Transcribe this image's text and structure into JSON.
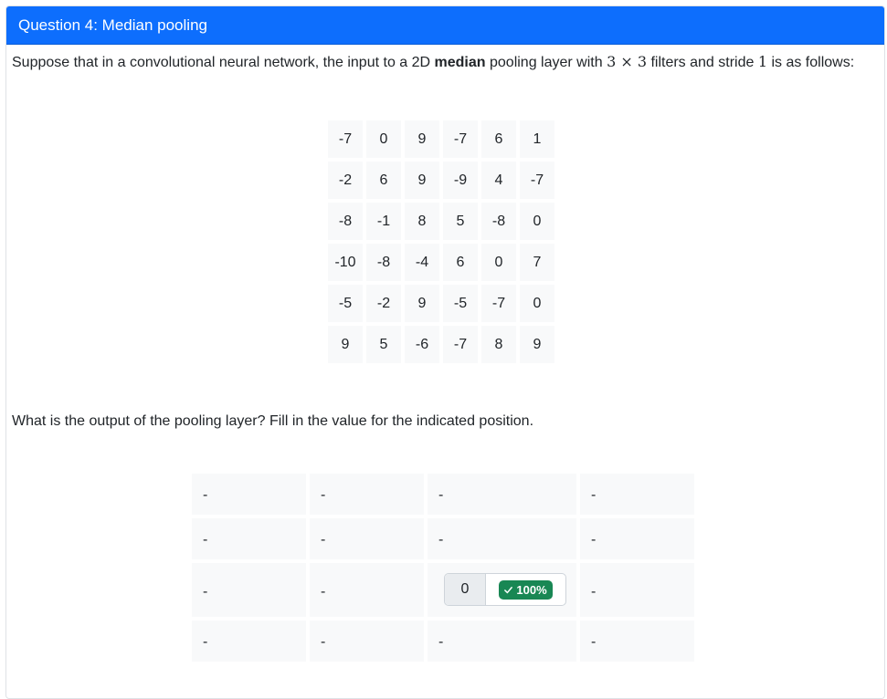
{
  "question": {
    "title": "Question 4: Median pooling",
    "prompt_before": "Suppose that in a convolutional neural network, the input to a 2D ",
    "prompt_bold": "median",
    "prompt_mid1": " pooling layer with ",
    "filter_size": "3 × 3",
    "prompt_mid2": " filters and stride ",
    "stride": "1",
    "prompt_after": " is as follows:",
    "follow_up": "What is the output of the pooling layer? Fill in the value for the indicated position."
  },
  "input_matrix": [
    [
      "-7",
      "0",
      "9",
      "-7",
      "6",
      "1"
    ],
    [
      "-2",
      "6",
      "9",
      "-9",
      "4",
      "-7"
    ],
    [
      "-8",
      "-1",
      "8",
      "5",
      "-8",
      "0"
    ],
    [
      "-10",
      "-8",
      "-4",
      "6",
      "0",
      "7"
    ],
    [
      "-5",
      "-2",
      "9",
      "-5",
      "-7",
      "0"
    ],
    [
      "9",
      "5",
      "-6",
      "-7",
      "8",
      "9"
    ]
  ],
  "output_matrix": [
    [
      "-",
      "-",
      "-",
      "-"
    ],
    [
      "-",
      "-",
      "-",
      "-"
    ],
    [
      "-",
      "-",
      "ANSWER",
      "-"
    ],
    [
      "-",
      "-",
      "-",
      "-"
    ]
  ],
  "answer": {
    "value": "0",
    "badge_label": "100%",
    "badge_icon": "check-icon",
    "badge_color": "#198754"
  },
  "colors": {
    "header_bg": "#0d6efd",
    "cell_bg": "#f8f9fa"
  }
}
